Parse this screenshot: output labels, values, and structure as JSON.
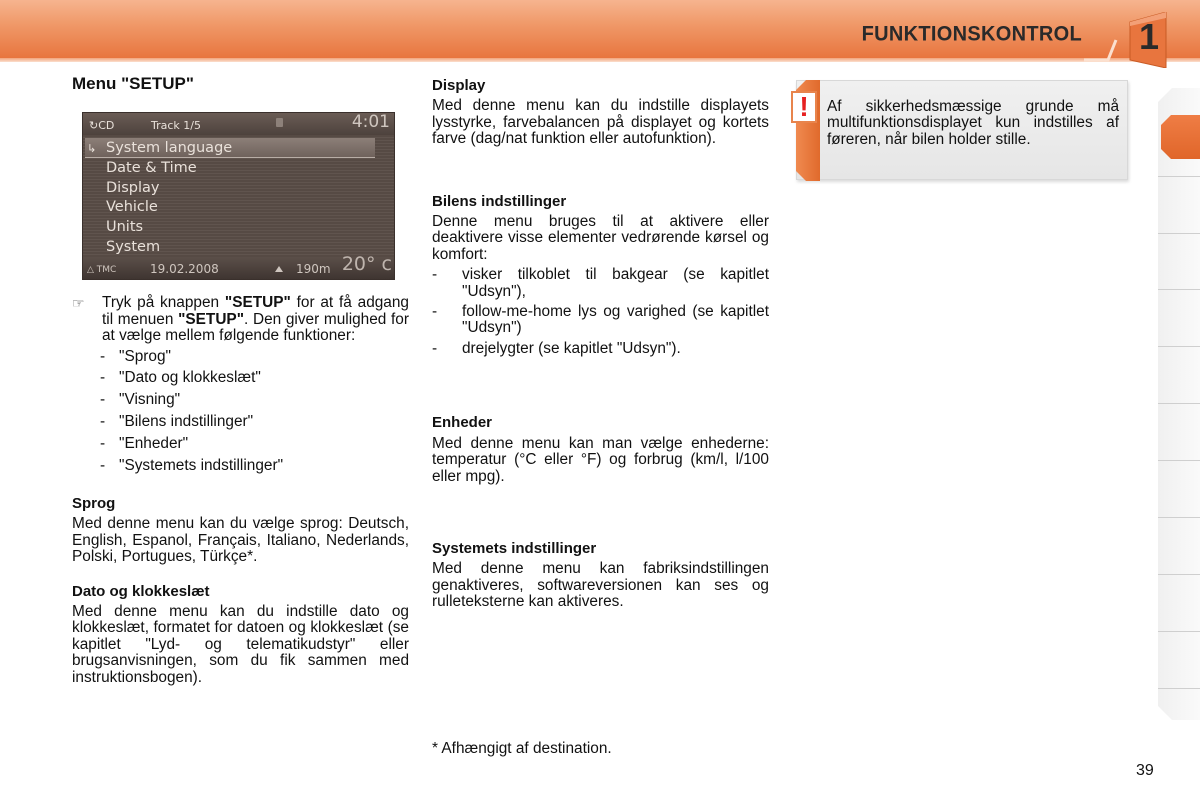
{
  "header": {
    "title": "FUNKTIONSKONTROL",
    "chapter": "1",
    "accent_color": "#e8753e"
  },
  "left_column": {
    "heading": "Menu \"SETUP\"",
    "screen": {
      "source_icon": "cd-icon",
      "source": "CD",
      "track": "Track 1/5",
      "clock": "4:01",
      "menu_items": [
        "System language",
        "Date & Time",
        "Display",
        "Vehicle",
        "Units",
        "System"
      ],
      "selected_index": 0,
      "tmc": "TMC",
      "date": "19.02.2008",
      "altitude": "190m",
      "temperature": "20° c"
    },
    "intro": {
      "icon": "pointing-hand-icon",
      "text_parts": [
        "Tryk på knappen ",
        "\"SETUP\"",
        " for at få adgang til menuen ",
        "\"SETUP\"",
        ". Den giver mulighed for at vælge mellem følgende funktioner:"
      ]
    },
    "options": [
      "\"Sprog\"",
      "\"Dato og klokkeslæt\"",
      "\"Visning\"",
      "\"Bilens indstillinger\"",
      "\"Enheder\"",
      "\"Systemets indstillinger\""
    ],
    "sections": [
      {
        "heading": "Sprog",
        "text": "Med denne menu kan du vælge sprog: Deutsch, English, Espanol, Français, Italiano, Nederlands, Polski, Portugues, Türkçe*."
      },
      {
        "heading": "Dato og klokkeslæt",
        "text": "Med denne menu kan du indstille dato og klokkeslæt, formatet for datoen og klokkeslæt (se kapitlet \"Lyd- og telematikudstyr\" eller brugsanvisningen, som du fik sammen med instruktionsbogen)."
      }
    ]
  },
  "middle_column": {
    "sections": [
      {
        "heading": "Display",
        "text": "Med denne menu kan du indstille displayets lysstyrke, farvebalancen på displayet og kortets farve (dag/nat funktion eller autofunktion)."
      },
      {
        "heading": "Bilens indstillinger",
        "text": "Denne menu bruges til at aktivere eller deaktivere visse elementer vedrørende kørsel og komfort:",
        "items": [
          "visker tilkoblet til bakgear (se kapitlet \"Udsyn\"),",
          "follow-me-home lys og varighed (se kapitlet \"Udsyn\")",
          "drejelygter (se kapitlet \"Udsyn\")."
        ]
      },
      {
        "heading": "Enheder",
        "text": "Med denne menu kan man vælge enhederne: temperatur (°C eller °F) og forbrug (km/l, l/100 eller mpg)."
      },
      {
        "heading": "Systemets indstillinger",
        "text": "Med denne menu kan fabriksindstillingen genaktiveres, softwareversionen kan ses og rulleteksterne kan aktiveres."
      }
    ],
    "footnote": "* Afhængigt af destination."
  },
  "warning": {
    "icon": "exclamation-icon",
    "text": "Af sikkerhedsmæssige grunde må multifunktionsdisplayet kun indstilles af føreren, når bilen holder stille."
  },
  "side_tabs": {
    "count": 10,
    "active_index": 0
  },
  "page_number": "39"
}
